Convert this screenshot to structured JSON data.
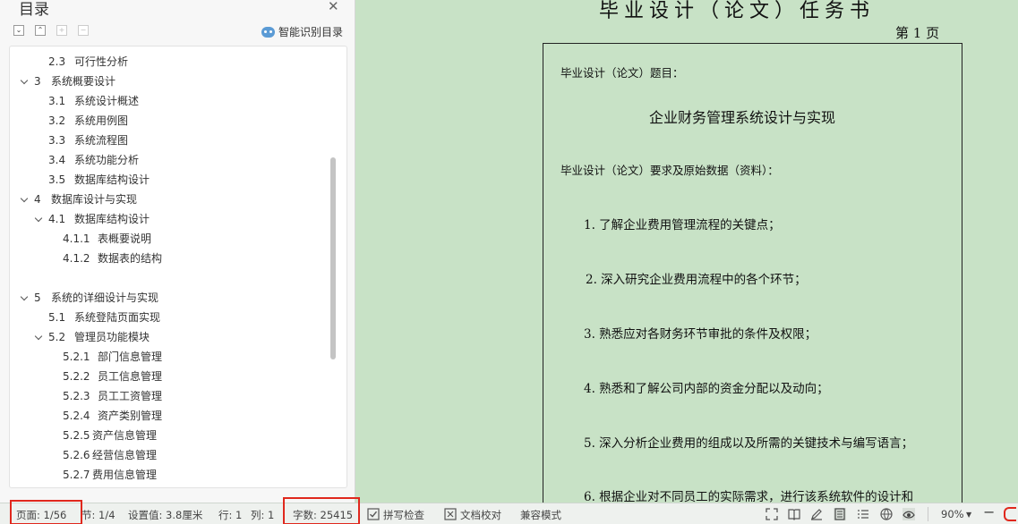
{
  "toc": {
    "title": "目录",
    "smart_label": "智能识别目录",
    "items": [
      {
        "num": "2.3",
        "text": "可行性分析"
      },
      {
        "num": "3",
        "text": "系统概要设计"
      },
      {
        "num": "3.1",
        "text": "系统设计概述"
      },
      {
        "num": "3.2",
        "text": "系统用例图"
      },
      {
        "num": "3.3",
        "text": "系统流程图"
      },
      {
        "num": "3.4",
        "text": "系统功能分析"
      },
      {
        "num": "3.5",
        "text": "数据库结构设计"
      },
      {
        "num": "4",
        "text": "数据库设计与实现"
      },
      {
        "num": "4.1",
        "text": "数据库结构设计"
      },
      {
        "num": "4.1.1",
        "text": "表概要说明"
      },
      {
        "num": "4.1.2",
        "text": "数据表的结构"
      },
      {
        "num": "5",
        "text": "系统的详细设计与实现"
      },
      {
        "num": "5.1",
        "text": "系统登陆页面实现"
      },
      {
        "num": "5.2",
        "text": "管理员功能模块"
      },
      {
        "num": "5.2.1",
        "text": "部门信息管理"
      },
      {
        "num": "5.2.2",
        "text": "员工信息管理"
      },
      {
        "num": "5.2.3",
        "text": "员工工资管理"
      },
      {
        "num": "5.2.4",
        "text": "资产类别管理"
      },
      {
        "num": "5.2.5",
        "text": "资产信息管理"
      },
      {
        "num": "5.2.6",
        "text": "经营信息管理"
      },
      {
        "num": "5.2.7",
        "text": "费用信息管理"
      }
    ]
  },
  "document": {
    "title": "毕业设计（论文）任务书",
    "page_label": "第 1 页",
    "topic_label": "毕业设计（论文）题目：",
    "topic": "企业财务管理系统设计与实现",
    "requirements_label": "毕业设计（论文）要求及原始数据（资料）：",
    "requirements": [
      "1. 了解企业费用管理流程的关键点；",
      "2. 深入研究企业费用流程中的各个环节；",
      "3. 熟悉应对各财务环节审批的条件及权限；",
      "4. 熟悉和了解公司内部的资金分配以及动向；",
      "5. 深入分析企业费用的组成以及所需的关键技术与编写语言；",
      "6. 根据企业对不同员工的实际需求，进行该系统软件的设计和"
    ]
  },
  "status": {
    "page": "页面: 1/56",
    "section": "节: 1/4",
    "setting": "设置值: 3.8厘米",
    "row": "行: 1",
    "col": "列: 1",
    "word_count": "字数: 25415",
    "spell_check": "拼写检查",
    "doc_proof": "文档校对",
    "compat_mode": "兼容模式",
    "zoom": "90%",
    "highlight_color": "#e0281d"
  }
}
